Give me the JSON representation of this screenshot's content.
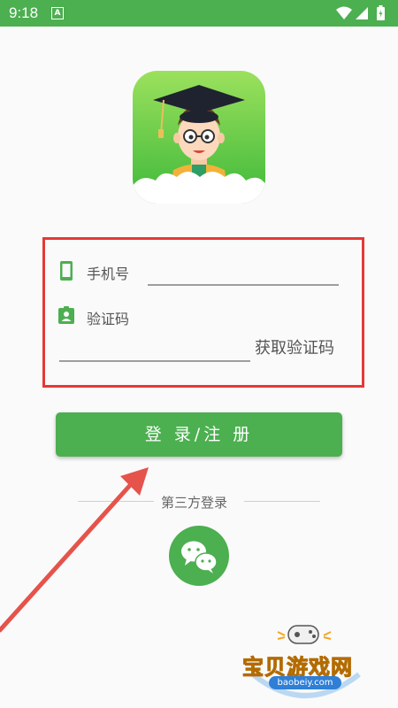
{
  "status_bar": {
    "time": "9:18",
    "notification_letter": "A",
    "background_color": "#4caf50"
  },
  "colors": {
    "accent": "#4caf50",
    "form_border": "#e53935",
    "arrow": "#e5534b"
  },
  "logo": {
    "icon": "graduate-boy-logo"
  },
  "form": {
    "phone_label": "手机号",
    "phone_value": "",
    "phone_icon": "smartphone-icon",
    "code_label": "验证码",
    "code_value": "",
    "code_icon": "badge-icon",
    "get_code_label": "获取验证码"
  },
  "login_button": {
    "label": "登 录/注 册"
  },
  "third_party": {
    "label": "第三方登录",
    "wechat_icon": "wechat-icon"
  },
  "watermark": {
    "title": "宝贝游戏网",
    "url": "baobeiy.com"
  }
}
